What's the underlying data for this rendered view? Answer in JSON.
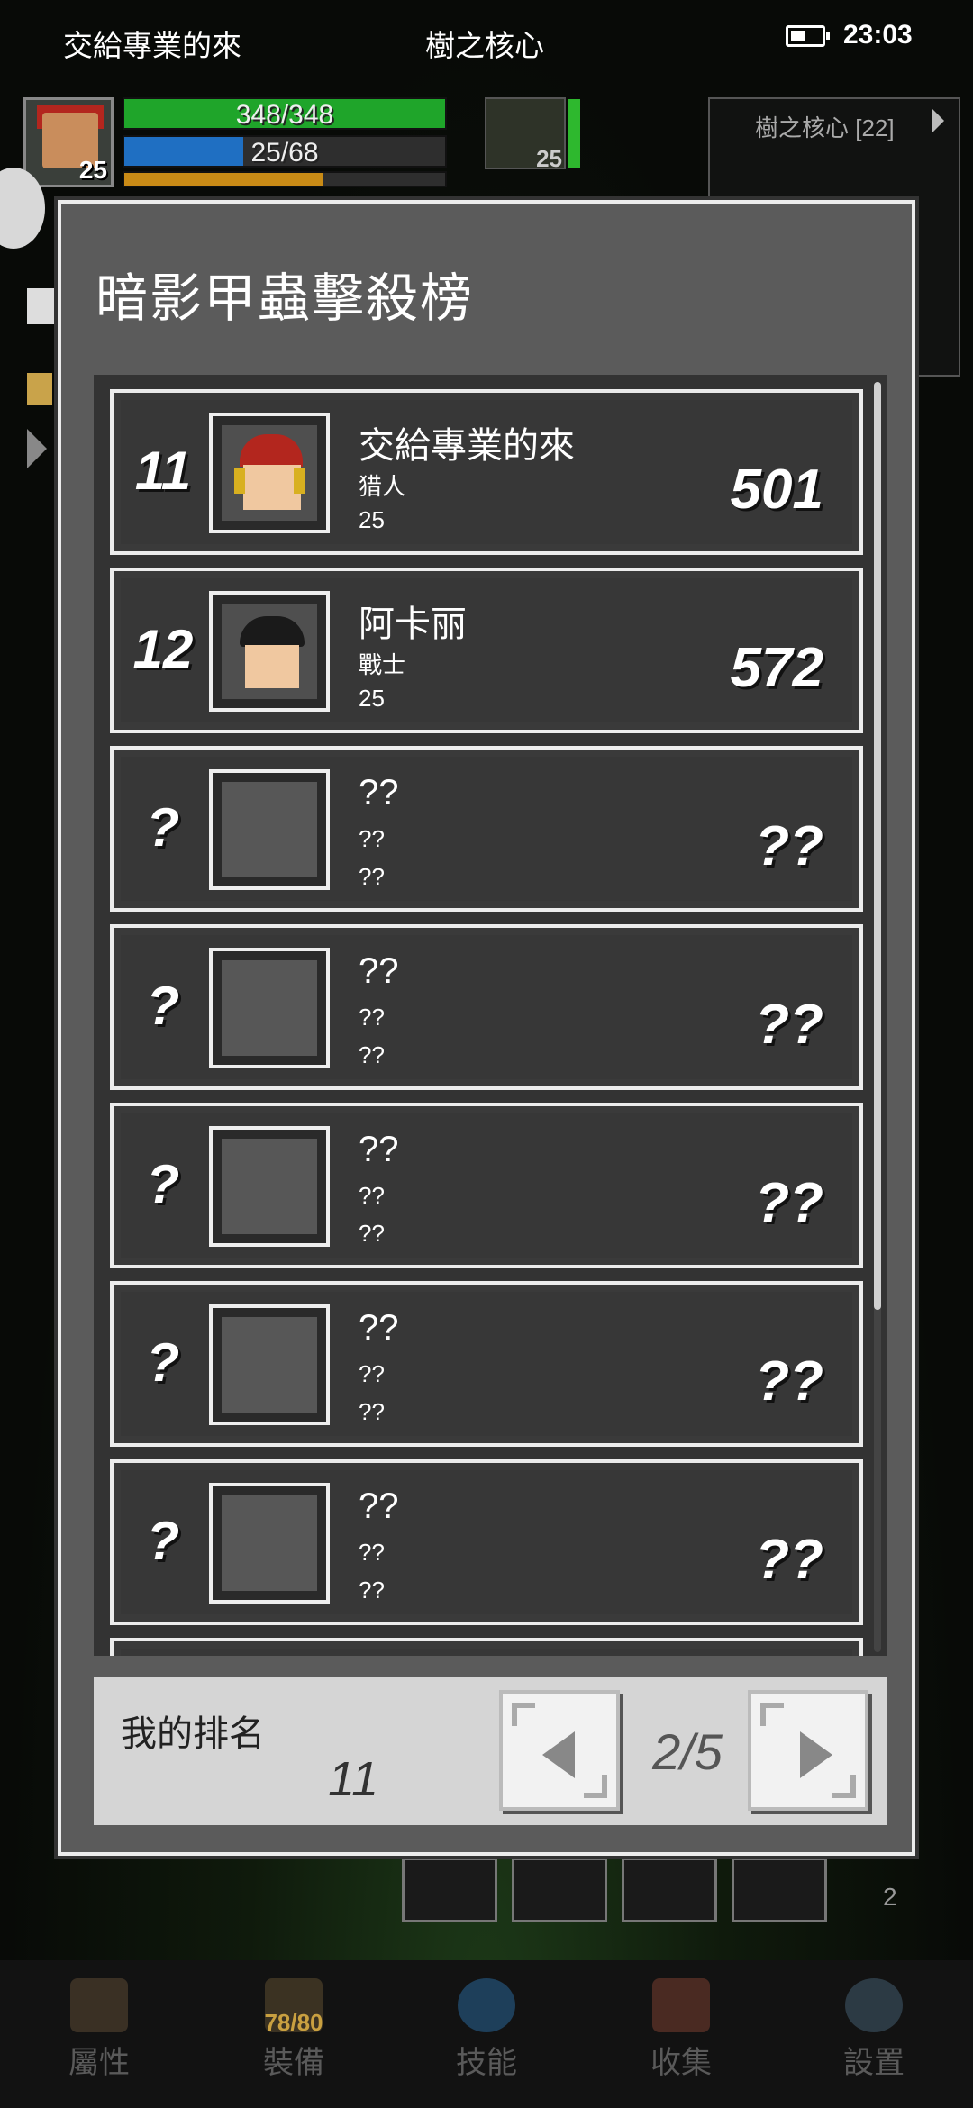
{
  "status_bar": {
    "left_title": "交給專業的來",
    "center_title": "樹之核心",
    "time": "23:03"
  },
  "hud": {
    "player_level": "25",
    "hp_text": "348/348",
    "hp_fraction": 1.0,
    "mp_text": "25/68",
    "mp_fraction": 0.37,
    "xp_fraction": 0.62,
    "pet_level": "25",
    "minimap_label": "樹之核心 [22]",
    "colors": {
      "hp": "#1fa52a",
      "mp": "#1f6fc2",
      "xp": "#c98b16"
    }
  },
  "dialog": {
    "title": "暗影甲蟲擊殺榜",
    "rows": [
      {
        "rank": "11",
        "name": "交給專業的來",
        "class": "猎人",
        "level": "25",
        "score": "501",
        "avatar": "red-hat-hunter"
      },
      {
        "rank": "12",
        "name": "阿卡丽",
        "class": "戰士",
        "level": "25",
        "score": "572",
        "avatar": "black-hair-warrior"
      },
      {
        "rank": "?",
        "name": "??",
        "class": "??",
        "level": "??",
        "score": "??",
        "avatar": "empty"
      },
      {
        "rank": "?",
        "name": "??",
        "class": "??",
        "level": "??",
        "score": "??",
        "avatar": "empty"
      },
      {
        "rank": "?",
        "name": "??",
        "class": "??",
        "level": "??",
        "score": "??",
        "avatar": "empty"
      },
      {
        "rank": "?",
        "name": "??",
        "class": "??",
        "level": "??",
        "score": "??",
        "avatar": "empty"
      },
      {
        "rank": "?",
        "name": "??",
        "class": "??",
        "level": "??",
        "score": "??",
        "avatar": "empty"
      }
    ],
    "my_rank_label": "我的排名",
    "my_rank_value": "11",
    "page_indicator": "2/5"
  },
  "bottom_nav": [
    {
      "label": "屬性",
      "icon": "helmet-icon"
    },
    {
      "label": "裝備",
      "icon": "chest-icon",
      "badge": "78/80"
    },
    {
      "label": "技能",
      "icon": "skill-orb-icon"
    },
    {
      "label": "收集",
      "icon": "book-icon"
    },
    {
      "label": "設置",
      "icon": "gear-icon"
    }
  ],
  "background_badge": "2"
}
